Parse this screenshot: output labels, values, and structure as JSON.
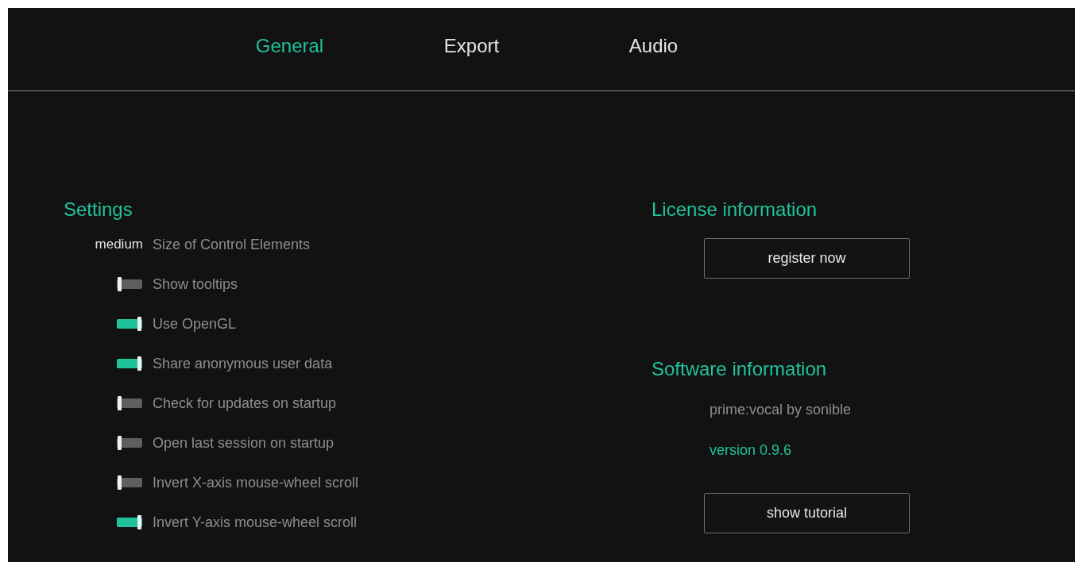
{
  "tabs": [
    {
      "label": "General",
      "selected": true
    },
    {
      "label": "Export",
      "selected": false
    },
    {
      "label": "Audio",
      "selected": false
    }
  ],
  "settings": {
    "title": "Settings",
    "items": [
      {
        "kind": "select",
        "value": "medium",
        "label": "Size of Control Elements"
      },
      {
        "kind": "toggle",
        "on": false,
        "label": "Show tooltips"
      },
      {
        "kind": "toggle",
        "on": true,
        "label": "Use OpenGL"
      },
      {
        "kind": "toggle",
        "on": true,
        "label": "Share anonymous user data"
      },
      {
        "kind": "toggle",
        "on": false,
        "label": "Check for updates on startup"
      },
      {
        "kind": "toggle",
        "on": false,
        "label": "Open last session on startup"
      },
      {
        "kind": "toggle",
        "on": false,
        "label": "Invert X-axis mouse-wheel scroll"
      },
      {
        "kind": "toggle",
        "on": true,
        "label": "Invert Y-axis mouse-wheel scroll"
      }
    ]
  },
  "license": {
    "title": "License information",
    "button": "register now"
  },
  "software": {
    "title": "Software information",
    "product": "prime:vocal by sonible",
    "version": "version 0.9.6",
    "button": "show tutorial"
  }
}
